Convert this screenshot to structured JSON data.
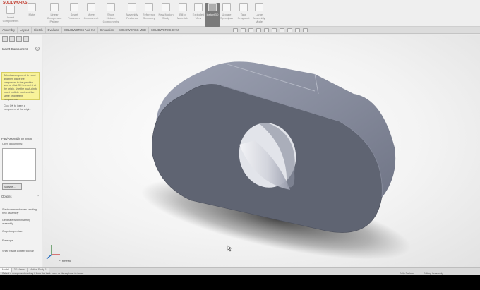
{
  "app": {
    "logo": "SOLIDWORKS"
  },
  "ribbon": {
    "buttons": [
      {
        "label": "Insert Components"
      },
      {
        "label": "Mate"
      },
      {
        "label": "Linear Component Pattern"
      },
      {
        "label": "Smart Fasteners"
      },
      {
        "label": "Move Component"
      },
      {
        "label": "Show Hidden Components"
      },
      {
        "label": "Assembly Features"
      },
      {
        "label": "Reference Geometry"
      },
      {
        "label": "New Motion Study"
      },
      {
        "label": "Bill of Materials"
      },
      {
        "label": "Exploded View"
      },
      {
        "label": "Instant3D"
      },
      {
        "label": "Update Speedpak"
      },
      {
        "label": "Take Snapshot"
      },
      {
        "label": "Large Assembly Mode"
      }
    ]
  },
  "tabs": [
    "Assembly",
    "Layout",
    "Sketch",
    "Evaluate",
    "SOLIDWORKS Add-Ins",
    "Simulation",
    "SOLIDWORKS MBD",
    "SOLIDWORKS CAM"
  ],
  "panel": {
    "title": "Insert Component",
    "help": "?",
    "message": "Select a component to insert and then place the component in the graphics area or click OK to insert it at the origin. Use the push-pin to insert multiple copies of the same or different components.",
    "message_more": "Click OK to insert a component at the origin.",
    "part_section": "Part/Assembly to Insert",
    "open_documents_label": "Open documents:",
    "browse_button": "Browse...",
    "options_section": "Options",
    "opt_start": "Start command when creating new assembly",
    "opt_generate": "Generate when inserting assembly",
    "opt_preview": "Graphics preview",
    "opt_envelope": "Envelope",
    "opt_triad": "Show rotate context toolbar"
  },
  "viewport": {
    "triad_label": "*Trimetric"
  },
  "statusbar": {
    "tabs": [
      {
        "label": "Model"
      },
      {
        "label": "3D Views"
      },
      {
        "label": "Motion Study 1"
      }
    ],
    "message": "Select a component or drag it from the task pane or file explorer to insert",
    "defined": "Fully Defined",
    "editing": "Editing Assembly"
  },
  "colors": {
    "part_face": "#5f6472",
    "part_side": "#8e93a4",
    "help_box": "#f8f29a"
  }
}
